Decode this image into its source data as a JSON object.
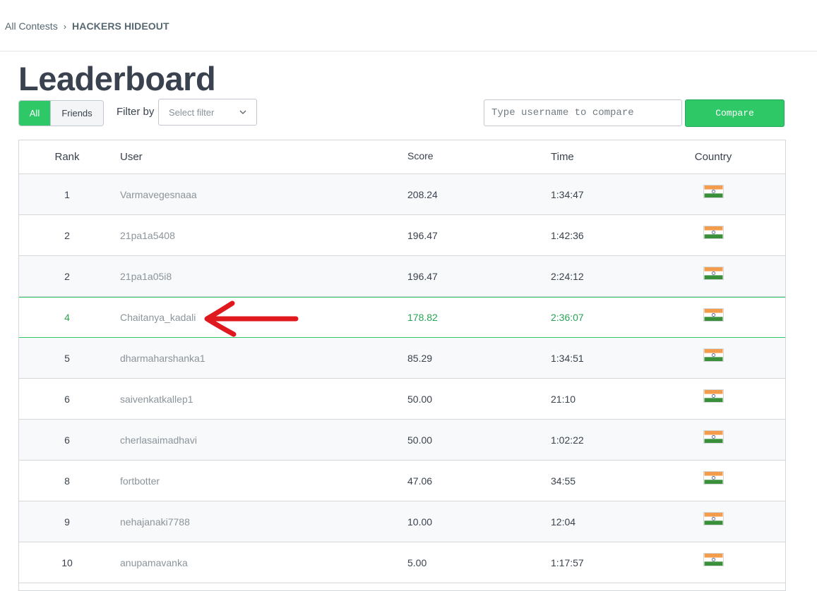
{
  "breadcrumb": {
    "root": "All Contests",
    "separator": "›",
    "current": "HACKERS HIDEOUT"
  },
  "page_title": "Leaderboard",
  "filters": {
    "all_label": "All",
    "friends_label": "Friends",
    "filter_by_label": "Filter by",
    "select_placeholder": "Select filter"
  },
  "compare": {
    "input_placeholder": "Type username to compare",
    "button_label": "Compare"
  },
  "table": {
    "headers": {
      "rank": "Rank",
      "user": "User",
      "score": "Score",
      "time": "Time",
      "country": "Country"
    },
    "rows": [
      {
        "rank": "1",
        "user": "Varmavegesnaaa",
        "score": "208.24",
        "time": "1:34:47",
        "country": "india-flag-icon"
      },
      {
        "rank": "2",
        "user": "21pa1a5408",
        "score": "196.47",
        "time": "1:42:36",
        "country": "india-flag-icon"
      },
      {
        "rank": "2",
        "user": "21pa1a05i8",
        "score": "196.47",
        "time": "2:24:12",
        "country": "india-flag-icon"
      },
      {
        "rank": "4",
        "user": "Chaitanya_kadali",
        "score": "178.82",
        "time": "2:36:07",
        "country": "india-flag-icon",
        "highlighted": true
      },
      {
        "rank": "5",
        "user": "dharmaharshanka1",
        "score": "85.29",
        "time": "1:34:51",
        "country": "india-flag-icon"
      },
      {
        "rank": "6",
        "user": "saivenkatkallep1",
        "score": "50.00",
        "time": "21:10",
        "country": "india-flag-icon"
      },
      {
        "rank": "6",
        "user": "cherlasaimadhavi",
        "score": "50.00",
        "time": "1:02:22",
        "country": "india-flag-icon"
      },
      {
        "rank": "8",
        "user": "fortbotter",
        "score": "47.06",
        "time": "34:55",
        "country": "india-flag-icon"
      },
      {
        "rank": "9",
        "user": "nehajanaki7788",
        "score": "10.00",
        "time": "12:04",
        "country": "india-flag-icon"
      },
      {
        "rank": "10",
        "user": "anupamavanka",
        "score": "5.00",
        "time": "1:17:57",
        "country": "india-flag-icon"
      }
    ]
  },
  "colors": {
    "accent": "#2ec866",
    "annotation_arrow": "#e0191f",
    "text": "#39424e",
    "muted_user": "#8a949b",
    "row_alt": "#f8f9fa"
  }
}
